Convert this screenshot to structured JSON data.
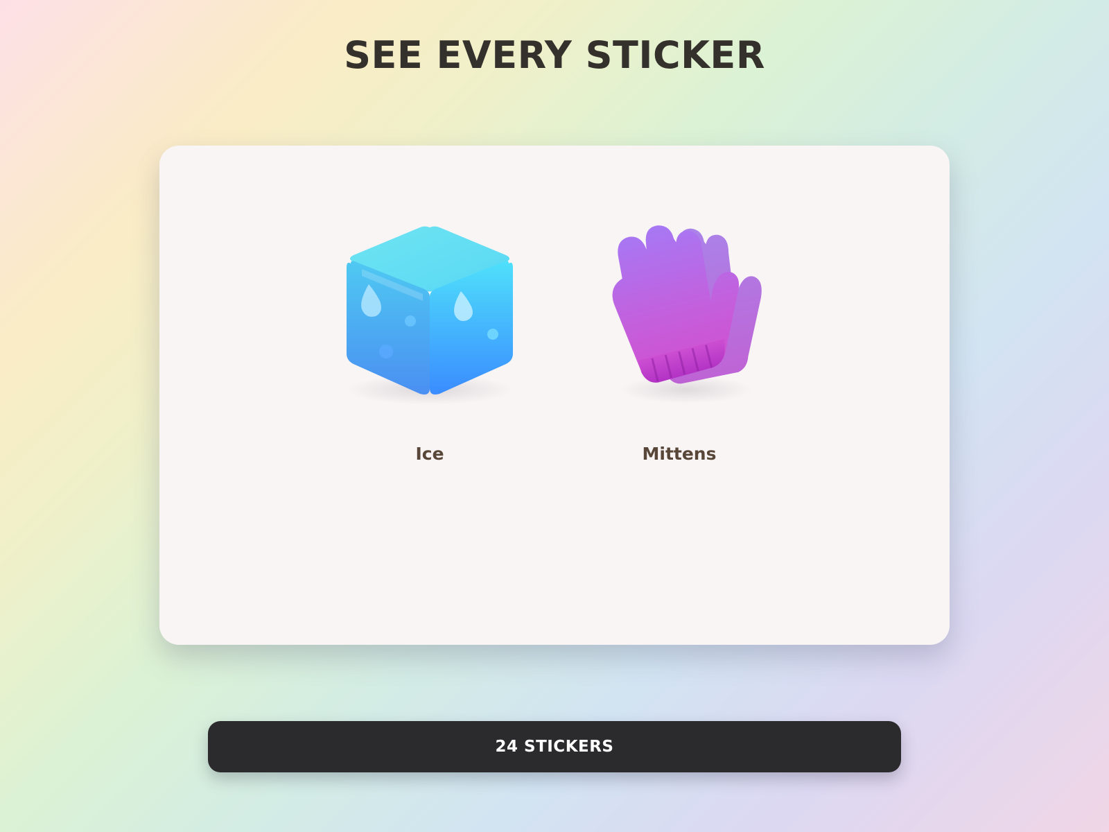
{
  "header": {
    "title": "SEE EVERY STICKER"
  },
  "stickers": [
    {
      "label": "Ice",
      "icon": "ice-cube-icon",
      "colors": [
        "#55e2f8",
        "#3aa8ff",
        "#6c7ef5"
      ]
    },
    {
      "label": "Mittens",
      "icon": "mittens-icon",
      "colors": [
        "#a36cf0",
        "#cf4fd6",
        "#9a3fc8"
      ]
    }
  ],
  "footer": {
    "count_label": "24 STICKERS"
  },
  "colors": {
    "title": "#34302b",
    "card": "#f9f5f5",
    "label": "#584739",
    "button": "#2b2a2d"
  }
}
